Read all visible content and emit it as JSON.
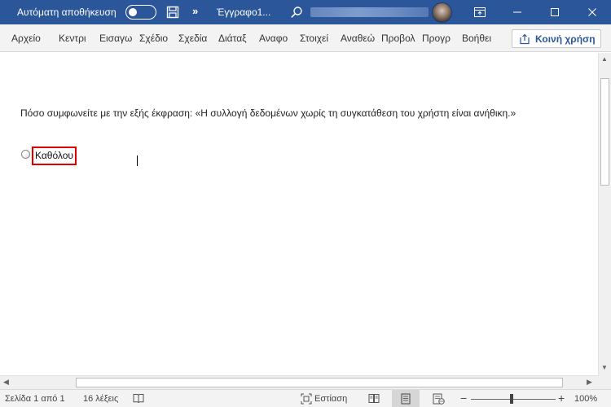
{
  "titlebar": {
    "autosave_label": "Αυτόματη αποθήκευση",
    "more_glyph": "»",
    "document_title": "Έγγραφο1..."
  },
  "ribbon": {
    "tabs": [
      {
        "label": "Αρχείο"
      },
      {
        "label": "Κεντρι"
      },
      {
        "label": "Εισαγω"
      },
      {
        "label": "Σχέδιο"
      },
      {
        "label": "Σχεδία"
      },
      {
        "label": "Διάταξ"
      },
      {
        "label": "Αναφο"
      },
      {
        "label": "Στοιχεί"
      },
      {
        "label": "Αναθεώ"
      },
      {
        "label": "Προβολ"
      },
      {
        "label": "Προγρ"
      },
      {
        "label": "Βοήθει"
      }
    ],
    "share_label": "Κοινή χρήση"
  },
  "document": {
    "question": "Πόσο συμφωνείτε με την εξής έκφραση: «Η συλλογή δεδομένων χωρίς τη συγκατάθεση του χρήστη είναι ανήθικη.»",
    "option_label": "Καθόλου"
  },
  "statusbar": {
    "page_info": "Σελίδα 1 από 1",
    "word_count": "16 λέξεις",
    "focus_label": "Εστίαση",
    "zoom_minus": "−",
    "zoom_plus": "+",
    "zoom_level": "100%"
  },
  "colors": {
    "titlebar": "#2b579a",
    "highlight_border": "#e00000"
  }
}
